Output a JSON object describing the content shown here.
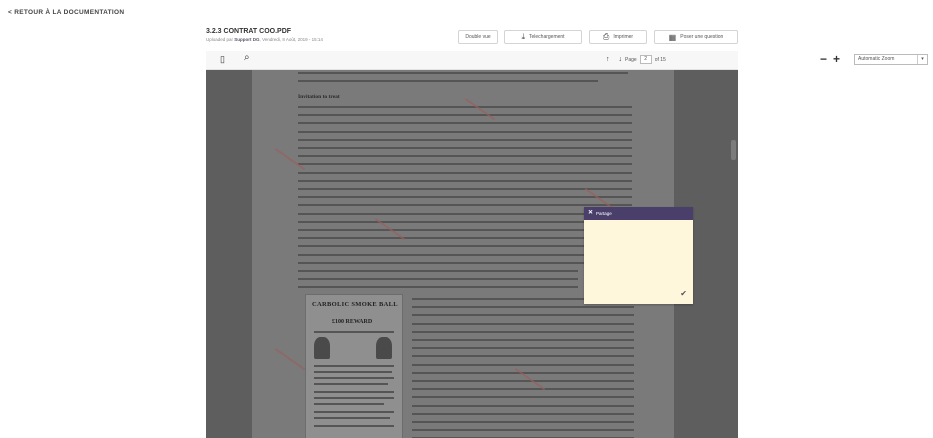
{
  "nav": {
    "back_label": "< RETOUR À LA DOCUMENTATION"
  },
  "document": {
    "title": "3.2.3 CONTRAT COO.PDF",
    "uploaded_prefix": "Uploaded par",
    "uploader": "Support DG",
    "uploaded_suffix": "Vendredi, 8 Août, 2019 - 15:14"
  },
  "header_buttons": {
    "double_page": "Double vue",
    "download": "Telechargement",
    "print": "Imprimer",
    "ask": "Poser une question"
  },
  "toolbar": {
    "page_label": "Page",
    "page_value": "2",
    "page_total": "of 15",
    "zoom": "Automatic Zoom"
  },
  "pdf": {
    "section_heading": "Invitation to treat",
    "clip_headline": "CARBOLIC SMOKE BALL",
    "clip_reward": "£100 REWARD"
  },
  "note": {
    "label": "Partage"
  },
  "icons": {
    "back": "chevron-left-icon",
    "double": "double-page-icon",
    "download": "download-icon",
    "print": "print-icon",
    "ask": "question-icon",
    "sidebar": "sidebar-toggle-icon",
    "search": "search-icon",
    "prev": "arrow-up-icon",
    "next": "arrow-down-icon",
    "zoom_out": "minus-icon",
    "zoom_in": "plus-icon",
    "close": "close-icon",
    "check": "check-icon"
  }
}
